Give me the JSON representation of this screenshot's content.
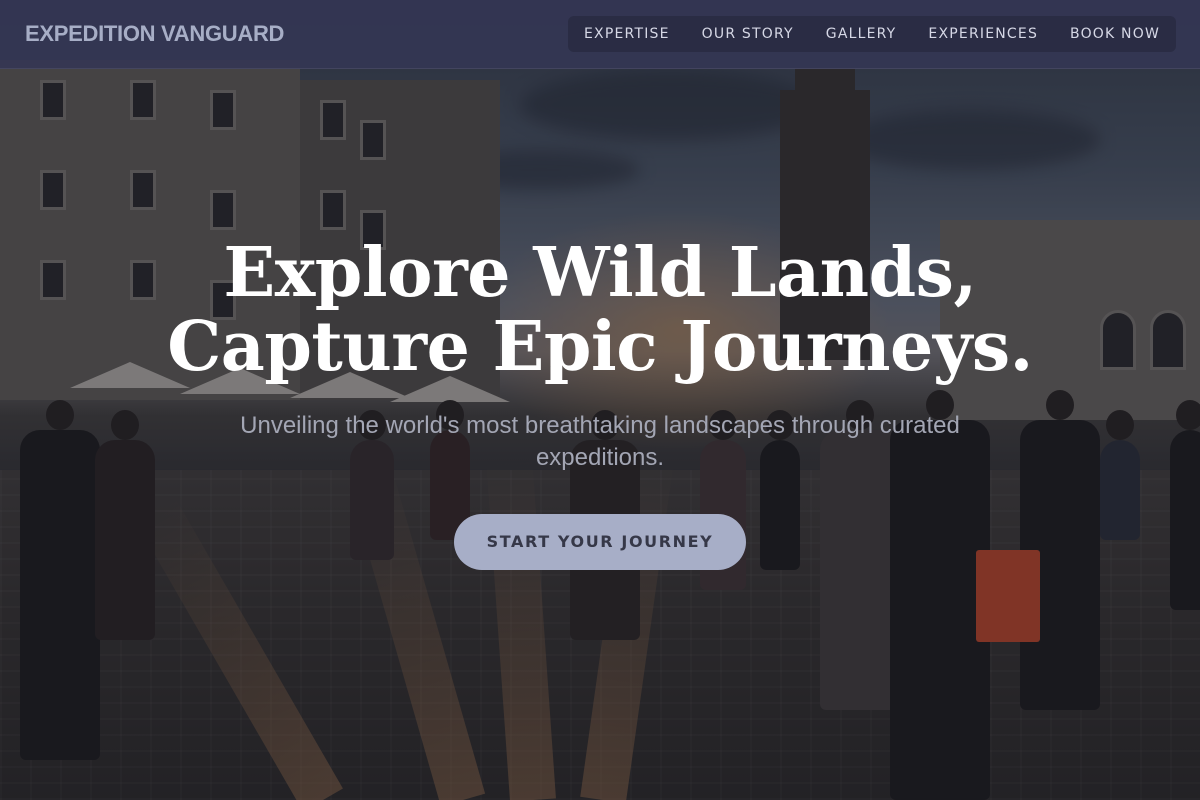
{
  "brand": {
    "name": "EXPEDITION VANGUARD"
  },
  "nav": {
    "links": [
      {
        "label": "EXPERTISE"
      },
      {
        "label": "OUR STORY"
      },
      {
        "label": "GALLERY"
      },
      {
        "label": "EXPERIENCES"
      },
      {
        "label": "BOOK NOW"
      }
    ]
  },
  "hero": {
    "title_line1": "Explore Wild Lands,",
    "title_line2": "Capture Epic Journeys.",
    "subtitle": "Unveiling the world's most breathtaking landscapes through curated expeditions.",
    "cta_label": "START YOUR JOURNEY",
    "background_image": "dusk city square with crowd of walking people",
    "image_alt": ""
  },
  "colors": {
    "nav_background": "#343654",
    "brand_text": "#a7aec6",
    "cta_background": "#a7aec7",
    "cta_text": "#363848",
    "hero_title": "#ffffff",
    "hero_subtitle": "#a3a6b4"
  }
}
